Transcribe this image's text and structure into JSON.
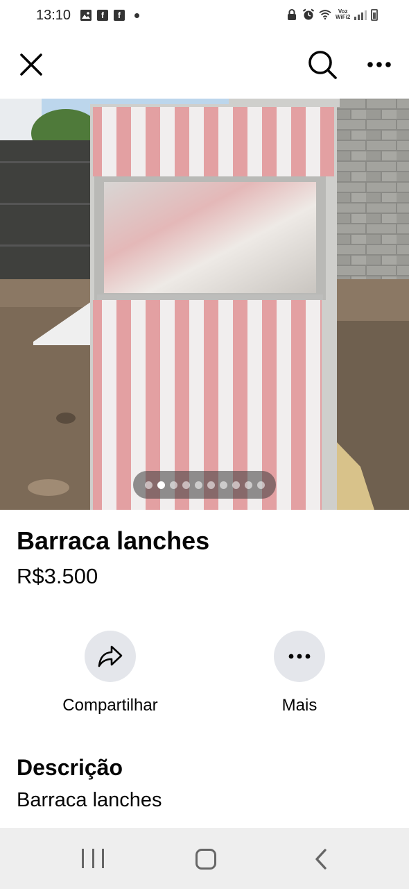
{
  "status_bar": {
    "time": "13:10",
    "left_icons": [
      "image-icon",
      "facebook-icon",
      "facebook-icon"
    ],
    "network_label_top": "Voz",
    "network_label_bottom": "WiFi2"
  },
  "top_bar": {
    "close_icon": "close-icon",
    "search_icon": "search-icon",
    "more_icon": "more-horizontal-icon"
  },
  "photo": {
    "description_icon": "product-photo",
    "pager": {
      "total": 10,
      "active_index": 1
    }
  },
  "listing": {
    "title": "Barraca lanches",
    "price": "R$3.500"
  },
  "actions": {
    "share_label": "Compartilhar",
    "more_label": "Mais"
  },
  "description": {
    "heading": "Descrição",
    "text": "Barraca lanches"
  },
  "nav_bar": {
    "recents_icon": "recents-icon",
    "home_icon": "home-icon",
    "back_icon": "back-icon"
  },
  "colors": {
    "action_circle": "#e4e6eb",
    "nav_bg": "#eeeeee",
    "stripe_pink": "#e8a4a6"
  }
}
